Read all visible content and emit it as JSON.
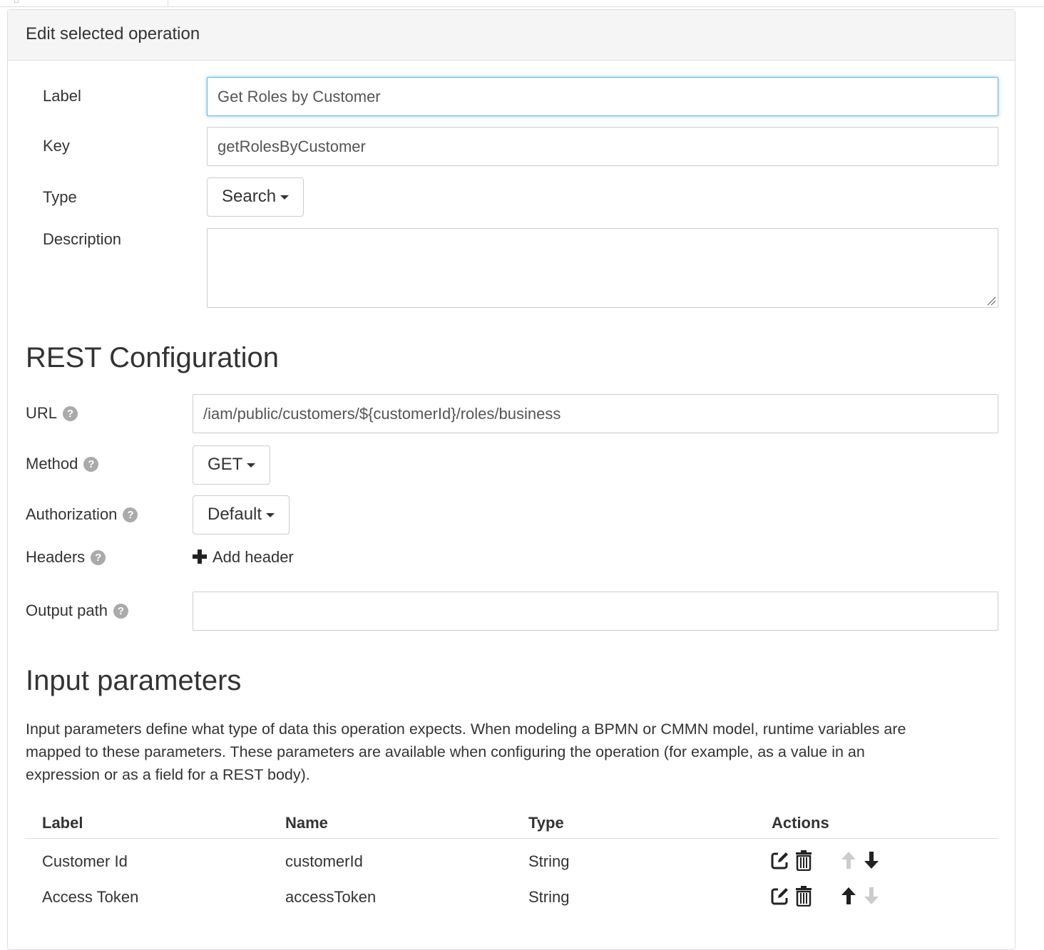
{
  "panel": {
    "title": "Edit selected operation"
  },
  "form": {
    "label": {
      "label": "Label",
      "value": "Get Roles by Customer"
    },
    "key": {
      "label": "Key",
      "value": "getRolesByCustomer"
    },
    "type": {
      "label": "Type",
      "value": "Search"
    },
    "description": {
      "label": "Description",
      "value": ""
    }
  },
  "rest": {
    "title": "REST Configuration",
    "url": {
      "label": "URL",
      "value": "/iam/public/customers/${customerId}/roles/business"
    },
    "method": {
      "label": "Method",
      "value": "GET"
    },
    "authorization": {
      "label": "Authorization",
      "value": "Default"
    },
    "headers": {
      "label": "Headers",
      "add_label": "Add header"
    },
    "output_path": {
      "label": "Output path",
      "value": ""
    },
    "help_glyph": "?"
  },
  "input_params": {
    "title": "Input parameters",
    "description": "Input parameters define what type of data this operation expects. When modeling a BPMN or CMMN model, runtime variables are mapped to these parameters. These parameters are available when configuring the operation (for example, as a value in an expression or as a field for a REST body).",
    "columns": [
      "Label",
      "Name",
      "Type",
      "Actions"
    ],
    "rows": [
      {
        "label": "Customer Id",
        "name": "customerId",
        "type": "String",
        "up_enabled": false,
        "down_enabled": true
      },
      {
        "label": "Access Token",
        "name": "accessToken",
        "type": "String",
        "up_enabled": true,
        "down_enabled": false
      }
    ]
  },
  "icons": [
    "edit-icon",
    "trash-icon",
    "arrow-up-icon",
    "arrow-down-icon",
    "plus-icon",
    "help-icon",
    "caret-down-icon"
  ],
  "colors": {
    "focus_border": "#66afe9",
    "disabled_arrow": "#cccccc",
    "enabled_arrow": "#222222"
  }
}
